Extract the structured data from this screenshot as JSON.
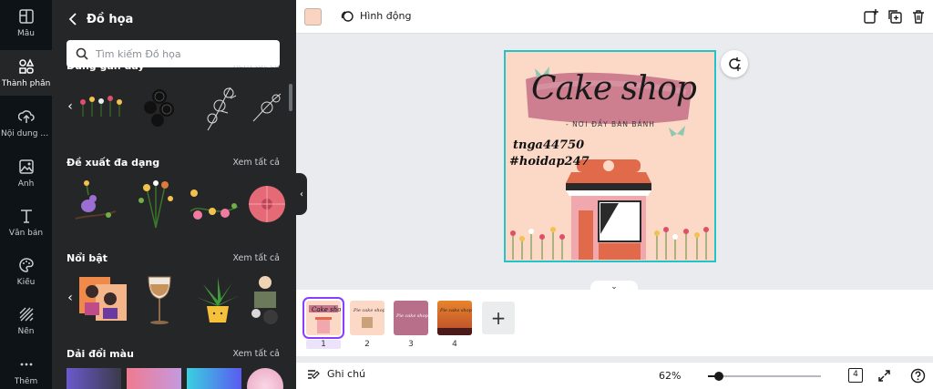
{
  "rail": [
    {
      "label": "Mẫu",
      "icon": "template-icon",
      "active": false
    },
    {
      "label": "Thành phần",
      "icon": "elements-icon",
      "active": true
    },
    {
      "label": "Nội dung t...",
      "icon": "upload-icon",
      "active": false
    },
    {
      "label": "Ảnh",
      "icon": "photo-icon",
      "active": false
    },
    {
      "label": "Văn bản",
      "icon": "text-icon",
      "active": false
    },
    {
      "label": "Kiểu",
      "icon": "palette-icon",
      "active": false
    },
    {
      "label": "Nền",
      "icon": "background-icon",
      "active": false
    },
    {
      "label": "Thêm",
      "icon": "more-icon",
      "active": false
    }
  ],
  "panel": {
    "title": "Đồ họa",
    "search_placeholder": "Tìm kiếm Đồ họa",
    "sections": [
      {
        "title": "Dùng gần đây",
        "link": "Xem tất cả"
      },
      {
        "title": "Đề xuất đa dạng",
        "link": "Xem tất cả"
      },
      {
        "title": "Nổi bật",
        "link": "Xem tất cả"
      },
      {
        "title": "Dải đổi màu",
        "link": "Xem tất cả"
      }
    ]
  },
  "toolbar": {
    "animate_label": "Hình động"
  },
  "design": {
    "title": "Cake shop",
    "subtitle": "- NƠI ĐẦY BÁN BÁNH",
    "watermark_1": "tnga44750",
    "watermark_2": "#hoidap247"
  },
  "pages": [
    {
      "num": "1",
      "active": true
    },
    {
      "num": "2",
      "active": false
    },
    {
      "num": "3",
      "active": false
    },
    {
      "num": "4",
      "active": false
    }
  ],
  "bottom": {
    "notes_label": "Ghi chú",
    "zoom": "62%",
    "zoom_fraction": 0.1,
    "page_count": "4"
  },
  "colors": {
    "accent": "#8b3dff",
    "selection": "#22c3c9",
    "canvas_bg": "#fbd9c6"
  }
}
